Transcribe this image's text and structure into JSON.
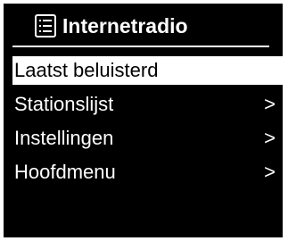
{
  "header": {
    "title": "Internetradio",
    "icon": "menu-list-icon"
  },
  "menu": {
    "items": [
      {
        "label": "Laatst beluisterd",
        "arrow": "",
        "selected": true
      },
      {
        "label": "Stationslijst",
        "arrow": ">",
        "selected": false
      },
      {
        "label": "Instellingen",
        "arrow": ">",
        "selected": false
      },
      {
        "label": "Hoofdmenu",
        "arrow": ">",
        "selected": false
      }
    ]
  },
  "colors": {
    "background": "#000000",
    "foreground": "#ffffff",
    "highlight": "#ffffff",
    "highlight_text": "#000000"
  }
}
